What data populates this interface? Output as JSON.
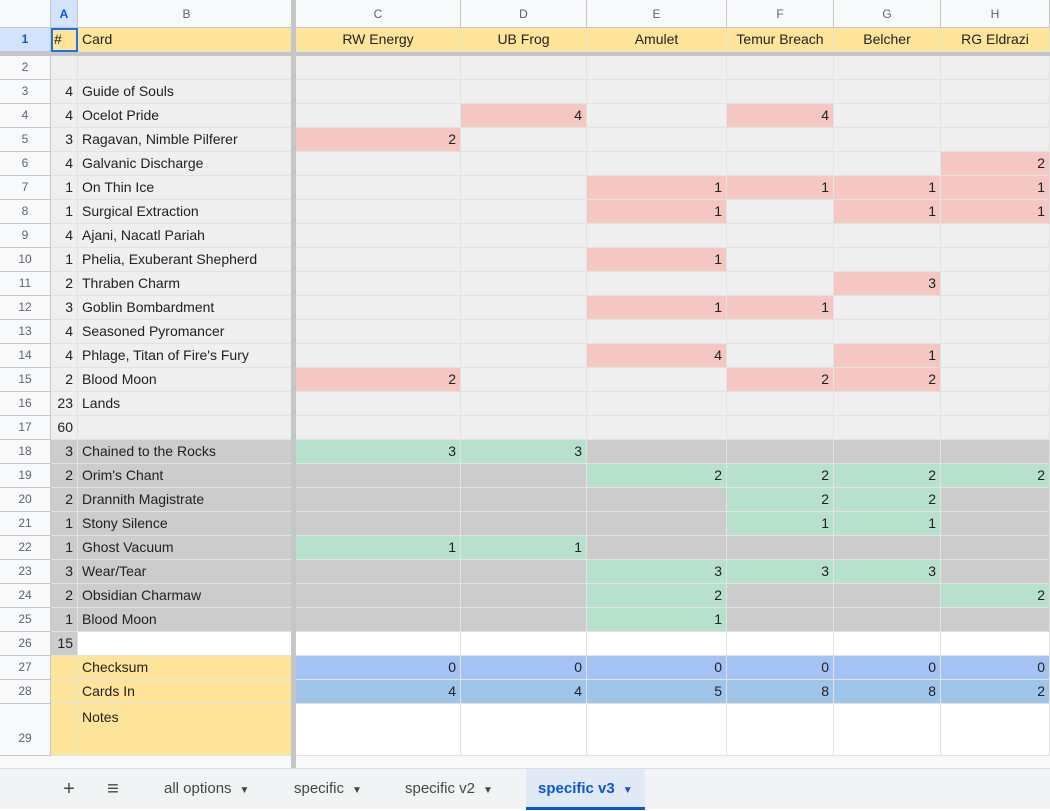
{
  "column_headers": [
    "A",
    "B",
    "C",
    "D",
    "E",
    "F",
    "G",
    "H"
  ],
  "header_row": {
    "count": "#",
    "card": "Card",
    "decks": [
      "RW Energy",
      "UB Frog",
      "Amulet",
      "Temur Breach",
      "Belcher",
      "RG Eldrazi"
    ]
  },
  "main_deck": [
    {
      "row": "2",
      "count": "",
      "card": "",
      "cells": [
        "",
        "",
        "",
        "",
        "",
        ""
      ]
    },
    {
      "row": "3",
      "count": "4",
      "card": "Guide of Souls",
      "cells": [
        "",
        "",
        "",
        "",
        "",
        ""
      ]
    },
    {
      "row": "4",
      "count": "4",
      "card": "Ocelot Pride",
      "cells": [
        "",
        "4",
        "",
        "4",
        "",
        ""
      ]
    },
    {
      "row": "5",
      "count": "3",
      "card": "Ragavan, Nimble Pilferer",
      "cells": [
        "2",
        "",
        "",
        "",
        "",
        ""
      ]
    },
    {
      "row": "6",
      "count": "4",
      "card": "Galvanic Discharge",
      "cells": [
        "",
        "",
        "",
        "",
        "",
        "2"
      ]
    },
    {
      "row": "7",
      "count": "1",
      "card": "On Thin Ice",
      "cells": [
        "",
        "",
        "1",
        "1",
        "1",
        "1"
      ]
    },
    {
      "row": "8",
      "count": "1",
      "card": "Surgical Extraction",
      "cells": [
        "",
        "",
        "1",
        "",
        "1",
        "1"
      ]
    },
    {
      "row": "9",
      "count": "4",
      "card": "Ajani, Nacatl Pariah",
      "cells": [
        "",
        "",
        "",
        "",
        "",
        ""
      ]
    },
    {
      "row": "10",
      "count": "1",
      "card": "Phelia, Exuberant Shepherd",
      "cells": [
        "",
        "",
        "1",
        "",
        "",
        ""
      ]
    },
    {
      "row": "11",
      "count": "2",
      "card": "Thraben Charm",
      "cells": [
        "",
        "",
        "",
        "",
        "3",
        ""
      ]
    },
    {
      "row": "12",
      "count": "3",
      "card": "Goblin Bombardment",
      "cells": [
        "",
        "",
        "1",
        "1",
        "",
        ""
      ]
    },
    {
      "row": "13",
      "count": "4",
      "card": "Seasoned Pyromancer",
      "cells": [
        "",
        "",
        "",
        "",
        "",
        ""
      ]
    },
    {
      "row": "14",
      "count": "4",
      "card": "Phlage, Titan of Fire's Fury",
      "cells": [
        "",
        "",
        "4",
        "",
        "1",
        ""
      ]
    },
    {
      "row": "15",
      "count": "2",
      "card": "Blood Moon",
      "cells": [
        "2",
        "",
        "",
        "2",
        "2",
        ""
      ]
    },
    {
      "row": "16",
      "count": "23",
      "card": "Lands",
      "cells": [
        "",
        "",
        "",
        "",
        "",
        ""
      ]
    },
    {
      "row": "17",
      "count": "60",
      "card": "",
      "cells": [
        "",
        "",
        "",
        "",
        "",
        ""
      ]
    }
  ],
  "sideboard": [
    {
      "row": "18",
      "count": "3",
      "card": "Chained to the Rocks",
      "cells": [
        "3",
        "3",
        "",
        "",
        "",
        ""
      ]
    },
    {
      "row": "19",
      "count": "2",
      "card": "Orim's Chant",
      "cells": [
        "",
        "",
        "2",
        "2",
        "2",
        "2"
      ]
    },
    {
      "row": "20",
      "count": "2",
      "card": "Drannith Magistrate",
      "cells": [
        "",
        "",
        "",
        "2",
        "2",
        ""
      ]
    },
    {
      "row": "21",
      "count": "1",
      "card": "Stony Silence",
      "cells": [
        "",
        "",
        "",
        "1",
        "1",
        ""
      ]
    },
    {
      "row": "22",
      "count": "1",
      "card": "Ghost Vacuum",
      "cells": [
        "1",
        "1",
        "",
        "",
        "",
        ""
      ]
    },
    {
      "row": "23",
      "count": "3",
      "card": "Wear/Tear",
      "cells": [
        "",
        "",
        "3",
        "3",
        "3",
        ""
      ]
    },
    {
      "row": "24",
      "count": "2",
      "card": "Obsidian Charmaw",
      "cells": [
        "",
        "",
        "2",
        "",
        "",
        "2"
      ]
    },
    {
      "row": "25",
      "count": "1",
      "card": "Blood Moon",
      "cells": [
        "",
        "",
        "1",
        "",
        "",
        ""
      ]
    },
    {
      "row": "26",
      "count": "15",
      "card": "",
      "cells": [
        "",
        "",
        "",
        "",
        "",
        ""
      ]
    }
  ],
  "summary": [
    {
      "row": "27",
      "label": "Checksum",
      "cells": [
        "0",
        "0",
        "0",
        "0",
        "0",
        "0"
      ]
    },
    {
      "row": "28",
      "label": "Cards In",
      "cells": [
        "4",
        "4",
        "5",
        "8",
        "8",
        "2"
      ]
    },
    {
      "row": "29",
      "label": "Notes",
      "cells": [
        "",
        "",
        "",
        "",
        "",
        ""
      ]
    }
  ],
  "sheet_tabs": [
    {
      "label": "all options",
      "active": false
    },
    {
      "label": "specific",
      "active": false
    },
    {
      "label": "specific v2",
      "active": false
    },
    {
      "label": "specific v3",
      "active": true
    }
  ],
  "icons": {
    "add_sheet": "plus-icon",
    "all_sheets": "menu-icon",
    "tab_menu": "caret-down-icon"
  },
  "colors": {
    "header_yellow": "#ffe599",
    "out_red": "#f4c7c3",
    "in_green": "#b7e1cd",
    "main_gray": "#efefef",
    "side_gray": "#cccccc",
    "checksum_blue": "#a4c2f4",
    "cardsin_blue": "#9fc5e8",
    "selection": "#1a73e8"
  }
}
